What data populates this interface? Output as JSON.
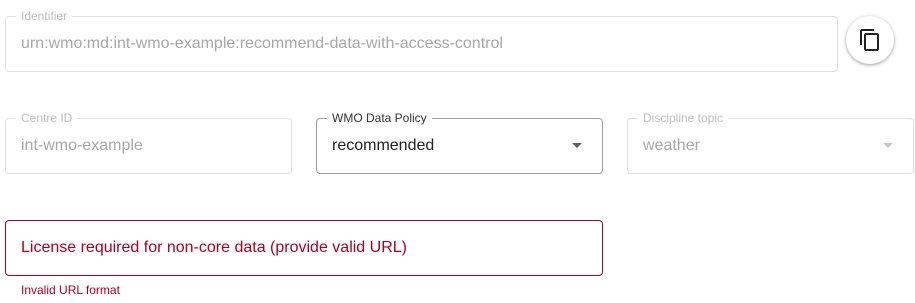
{
  "identifier": {
    "label": "Identifier",
    "value": "urn:wmo:md:int-wmo-example:recommend-data-with-access-control"
  },
  "copy_button": {
    "icon": "copy-icon"
  },
  "centre_id": {
    "label": "Centre ID",
    "value": "int-wmo-example"
  },
  "data_policy": {
    "label": "WMO Data Policy",
    "value": "recommended"
  },
  "discipline_topic": {
    "label": "Discipline topic",
    "value": "weather"
  },
  "license": {
    "value": "License required for non-core data (provide valid URL)",
    "helper": "Invalid URL format"
  },
  "colors": {
    "error": "#b00020",
    "disabled_text": "#a8a8a8",
    "border": "#e0e0e0"
  }
}
